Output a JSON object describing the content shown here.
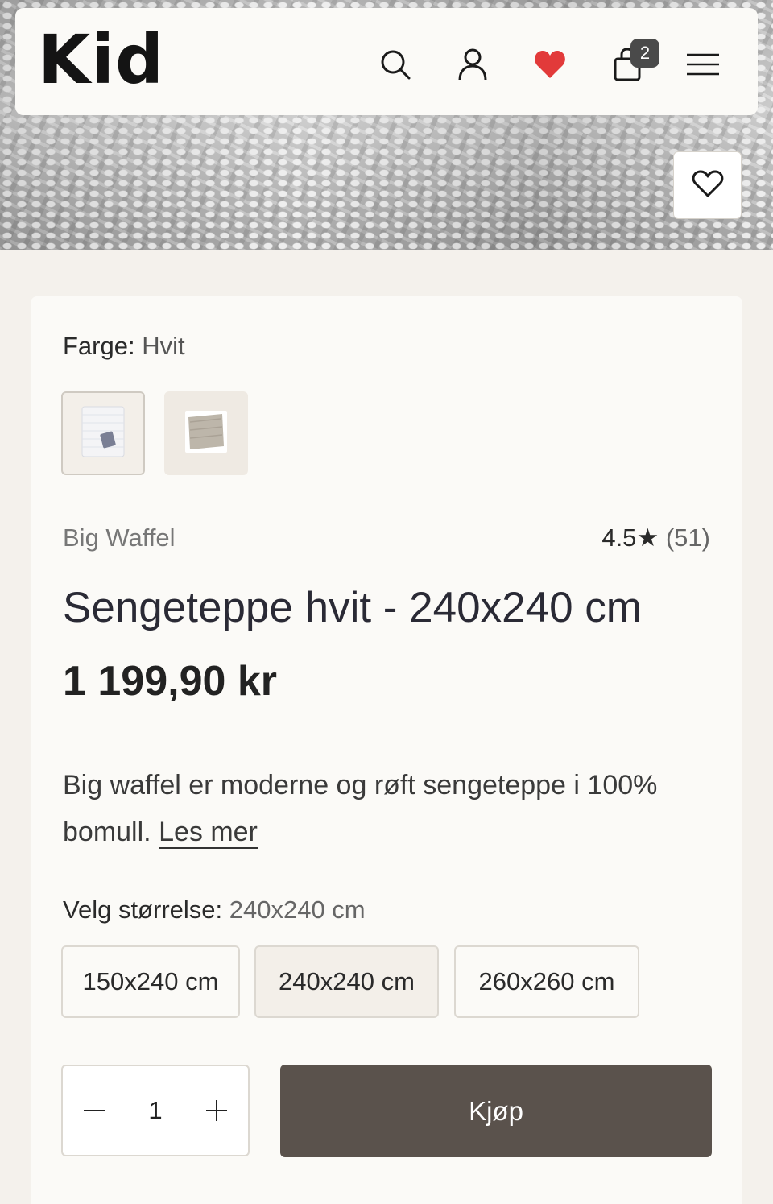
{
  "header": {
    "logo": "Kid",
    "cart_count": "2",
    "icons": [
      "search-icon",
      "user-icon",
      "heart-icon",
      "bag-icon",
      "menu-icon"
    ],
    "wishlist_color": "#e23a3a"
  },
  "product": {
    "color_label": "Farge:",
    "color_value": "Hvit",
    "swatches": [
      {
        "name": "Hvit",
        "selected": true
      },
      {
        "name": "Beige",
        "selected": false
      }
    ],
    "brand": "Big Waffel",
    "rating": "4.5",
    "rating_star": "★",
    "review_count": "(51)",
    "title": "Sengeteppe hvit - 240x240 cm",
    "price": "1 199,90 kr",
    "description": "Big waffel er moderne og røft sengeteppe i 100% bomull.",
    "read_more": "Les mer",
    "size_label": "Velg størrelse:",
    "size_value": "240x240 cm",
    "sizes": [
      "150x240 cm",
      "240x240 cm",
      "260x260 cm"
    ],
    "selected_size_index": 1,
    "quantity": "1",
    "buy_label": "Kjøp"
  },
  "colors": {
    "background": "#f4f1ec",
    "card": "#fbfaf7",
    "buy_button": "#5a524c",
    "heart": "#e23a3a"
  }
}
